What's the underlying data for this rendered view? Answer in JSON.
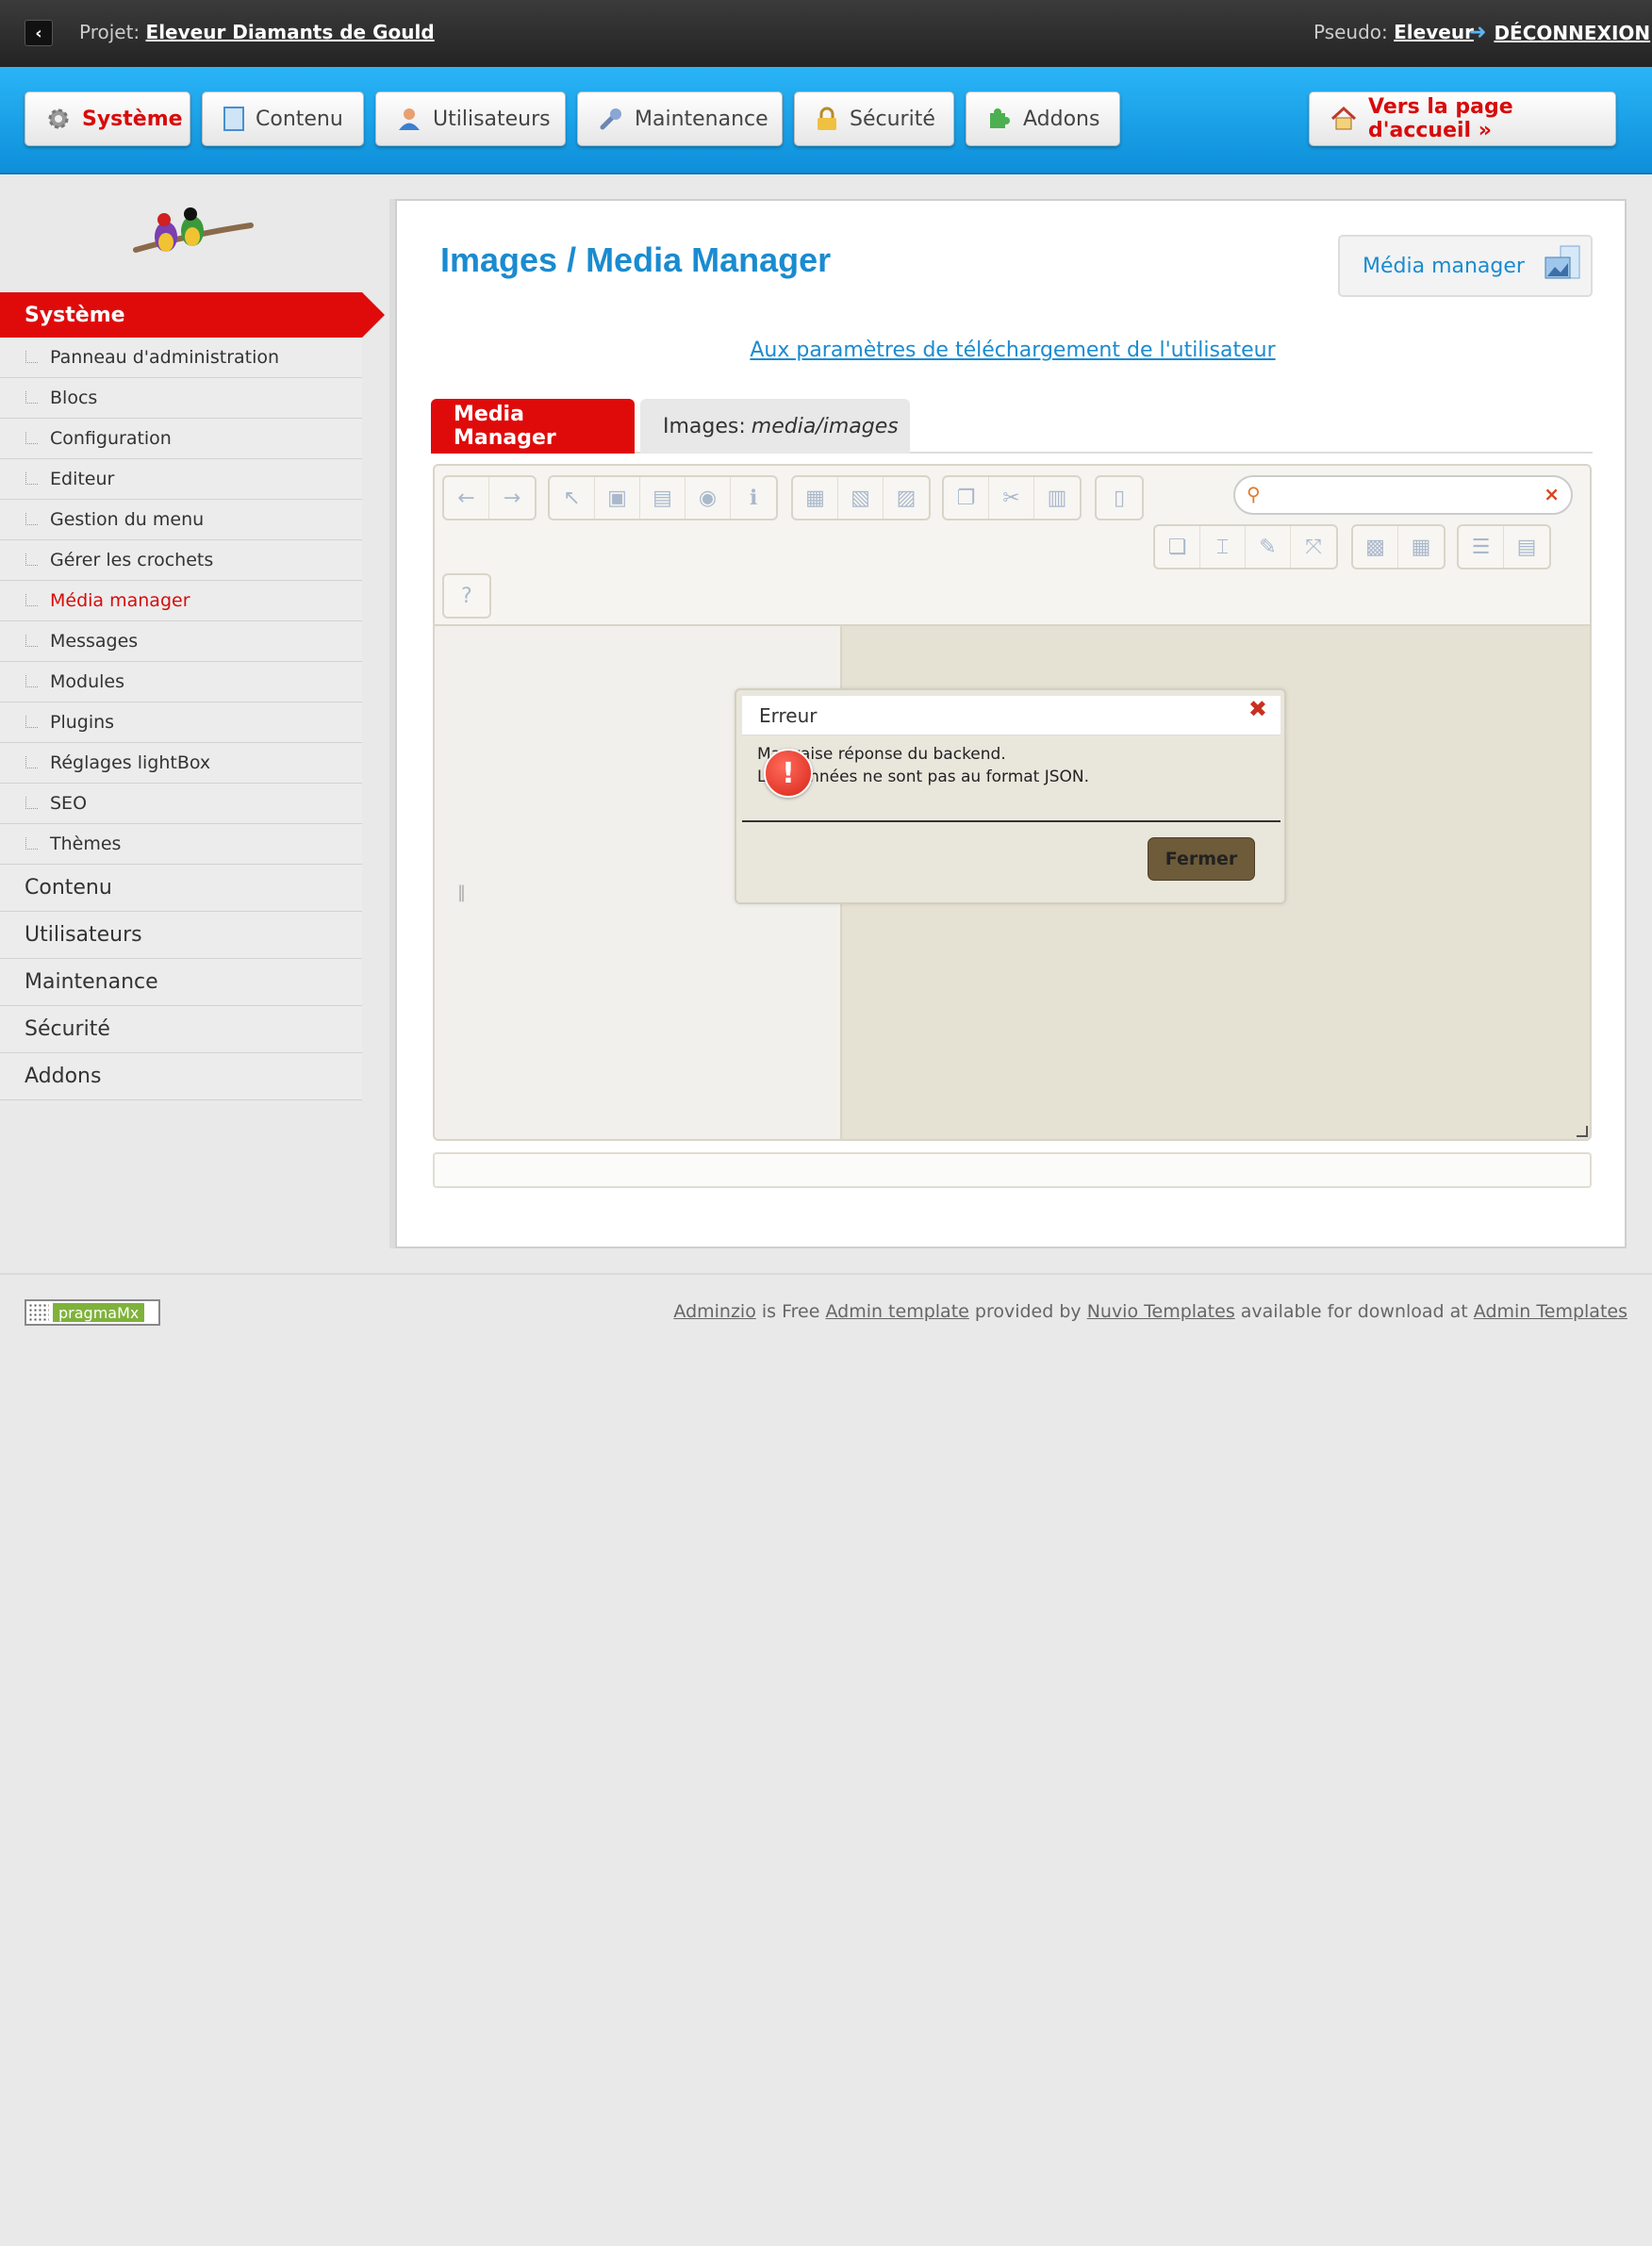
{
  "topbar": {
    "project_label": "Projet:",
    "project_name": "Eleveur Diamants de Gould",
    "pseudo_label": "Pseudo:",
    "pseudo_name": "Eleveur",
    "logout": "DÉCONNEXION"
  },
  "nav": {
    "items": [
      {
        "label": "Système",
        "icon": "gear-icon"
      },
      {
        "label": "Contenu",
        "icon": "document-icon"
      },
      {
        "label": "Utilisateurs",
        "icon": "user-icon"
      },
      {
        "label": "Maintenance",
        "icon": "wrench-icon"
      },
      {
        "label": "Sécurité",
        "icon": "lock-icon"
      },
      {
        "label": "Addons",
        "icon": "puzzle-icon"
      }
    ],
    "home": "Vers la page d'accueil »"
  },
  "sidebar": {
    "active": "Système",
    "subitems": [
      "Panneau d'administration",
      "Blocs",
      "Configuration",
      "Editeur",
      "Gestion du menu",
      "Gérer les crochets",
      "Média manager",
      "Messages",
      "Modules",
      "Plugins",
      "Réglages lightBox",
      "SEO",
      "Thèmes"
    ],
    "current_subitem": "Média manager",
    "mainitems": [
      "Contenu",
      "Utilisateurs",
      "Maintenance",
      "Sécurité",
      "Addons"
    ]
  },
  "main": {
    "title": "Images / Media Manager",
    "mm_button": "Média manager",
    "upload_link": "Aux paramètres de téléchargement de l'utilisateur",
    "tabs": {
      "active": "Media Manager",
      "inactive_prefix": "Images:",
      "inactive_path": "media/images"
    }
  },
  "dialog": {
    "title": "Erreur",
    "line1": "Mauvaise réponse du backend.",
    "line2": "Les données ne sont pas au format JSON.",
    "button": "Fermer"
  },
  "footer": {
    "badge": "pragmaMx",
    "credits": {
      "adminzio": "Adminzio",
      "t1": " is Free ",
      "admin_template": "Admin template",
      "t2": " provided by ",
      "nuvio": "Nuvio Templates",
      "t3": " available for download at ",
      "admin_templates": "Admin Templates"
    }
  },
  "colors": {
    "accent_blue": "#1a8bd0",
    "active_red": "#df0b0b",
    "dialog_button": "#6e5b3a"
  }
}
